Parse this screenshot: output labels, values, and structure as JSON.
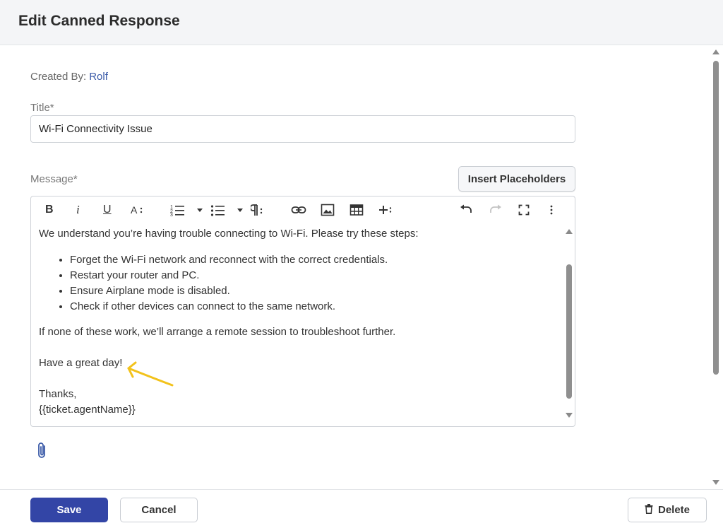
{
  "header": {
    "title": "Edit Canned Response"
  },
  "meta": {
    "created_by_label": "Created By:",
    "created_by_value": "Rolf"
  },
  "form": {
    "title_label": "Title*",
    "title_value": "Wi-Fi Connectivity Issue",
    "message_label": "Message*",
    "insert_placeholders_label": "Insert Placeholders"
  },
  "toolbar": {
    "icons": [
      "bold-icon",
      "italic-icon",
      "underline-icon",
      "font-size-icon",
      "ordered-list-icon",
      "unordered-list-icon",
      "paragraph-format-icon",
      "link-icon",
      "image-icon",
      "table-icon",
      "insert-more-icon",
      "undo-icon",
      "redo-icon",
      "fullscreen-icon",
      "more-options-icon"
    ],
    "bold": "B",
    "italic": "i",
    "underline": "U"
  },
  "message": {
    "intro": "We understand you’re having trouble connecting to Wi-Fi. Please try these steps:",
    "steps": [
      "Forget the Wi-Fi network and reconnect with the correct credentials.",
      "Restart your router and PC.",
      "Ensure Airplane mode is disabled.",
      "Check if other devices can connect to the same network."
    ],
    "followup": "If none of these work, we’ll arrange a remote session to troubleshoot further.",
    "closing": "Have a great day!",
    "signoff": "Thanks,",
    "signature": "{{ticket.agentName}}"
  },
  "footer": {
    "save_label": "Save",
    "cancel_label": "Cancel",
    "delete_label": "Delete"
  },
  "colors": {
    "primary": "#3345a6",
    "link": "#3a5aa8",
    "annotation": "#f2c21b"
  }
}
